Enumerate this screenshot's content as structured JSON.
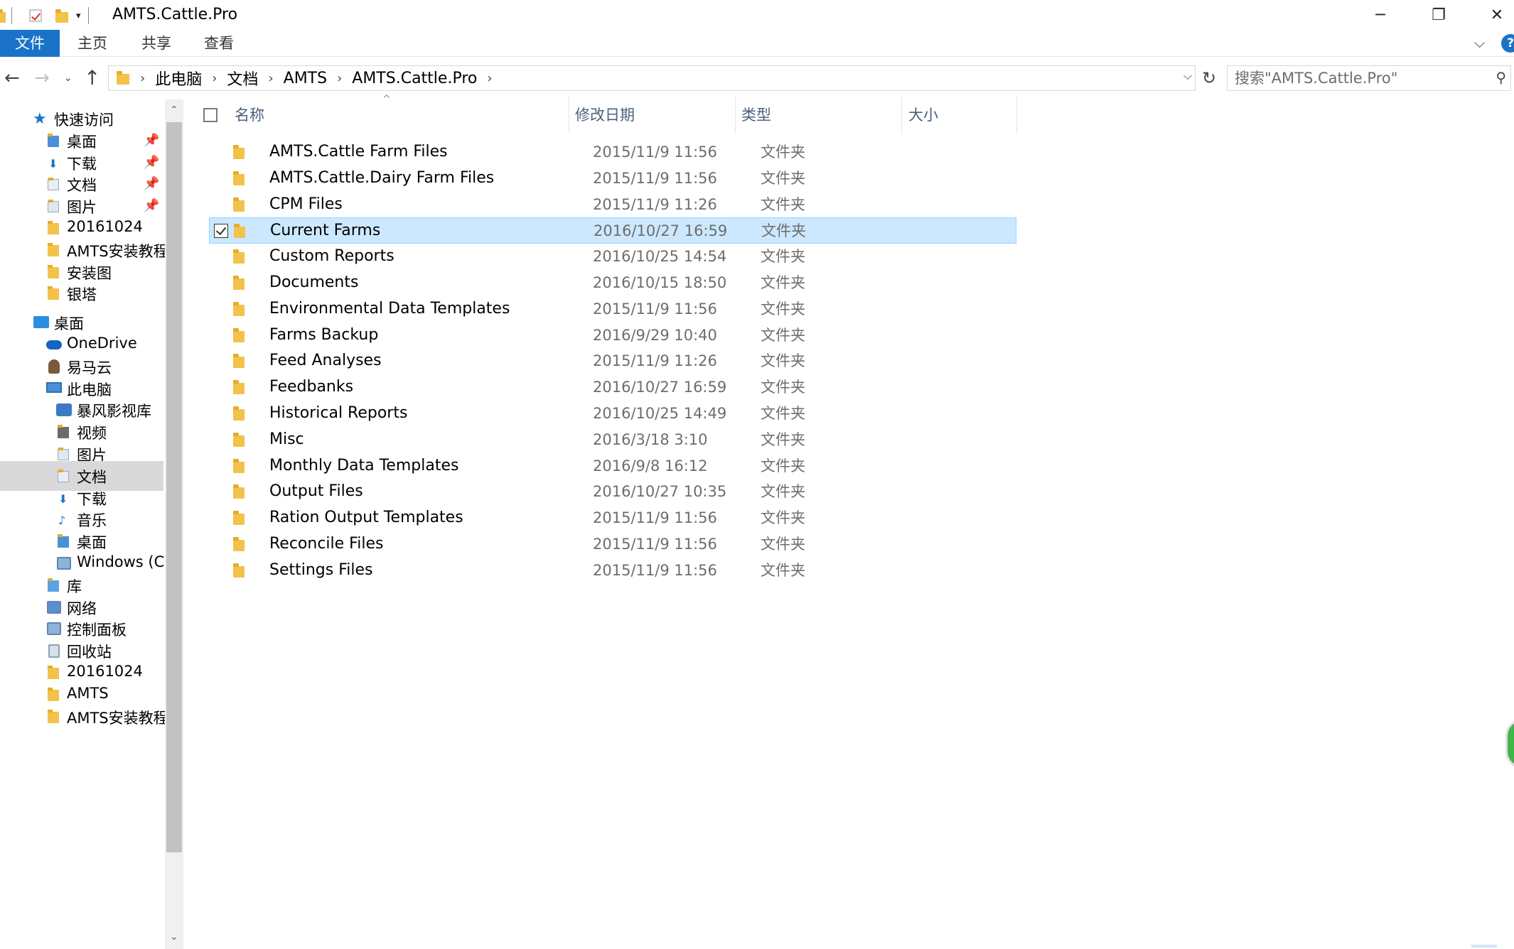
{
  "window": {
    "title": "AMTS.Cattle.Pro",
    "controls": {
      "minimize": "─",
      "maximize": "❐",
      "close": "✕"
    },
    "qat_dropdown": "▾"
  },
  "ribbon": {
    "tabs": [
      "文件",
      "主页",
      "共享",
      "查看"
    ],
    "expand_glyph": "⌵",
    "help_glyph": "?",
    "accent_color": "#1a73c9"
  },
  "navigation": {
    "back_glyph": "←",
    "forward_glyph": "→",
    "recent_glyph": "⌄",
    "up_glyph": "↑",
    "breadcrumb": [
      "此电脑",
      "文档",
      "AMTS",
      "AMTS.Cattle.Pro"
    ],
    "separator_glyph": "›",
    "dropdown_glyph": "⌵",
    "refresh_glyph": "↻",
    "search_placeholder": "搜索\"AMTS.Cattle.Pro\"",
    "search_glyph": "⚲"
  },
  "sidebar": {
    "pin_glyph": "📌",
    "items": [
      {
        "label": "快速访问",
        "icon": "star-icon",
        "indent": 0
      },
      {
        "label": "桌面",
        "icon": "desktop-folder-icon",
        "indent": 1,
        "pinned": true
      },
      {
        "label": "下载",
        "icon": "downloads-folder-icon",
        "indent": 1,
        "pinned": true
      },
      {
        "label": "文档",
        "icon": "documents-folder-icon",
        "indent": 1,
        "pinned": true
      },
      {
        "label": "图片",
        "icon": "pictures-folder-icon",
        "indent": 1,
        "pinned": true
      },
      {
        "label": "20161024",
        "icon": "folder-icon",
        "indent": 1
      },
      {
        "label": "AMTS安装教程",
        "icon": "folder-icon",
        "indent": 1
      },
      {
        "label": "安装图",
        "icon": "folder-icon",
        "indent": 1
      },
      {
        "label": "银塔",
        "icon": "folder-icon",
        "indent": 1
      },
      {
        "label": "桌面",
        "icon": "desktop-icon",
        "indent": 0
      },
      {
        "label": "OneDrive",
        "icon": "onedrive-icon",
        "indent": 1
      },
      {
        "label": "易马云",
        "icon": "user-folder-icon",
        "indent": 1
      },
      {
        "label": "此电脑",
        "icon": "computer-icon",
        "indent": 1
      },
      {
        "label": "暴风影视库",
        "icon": "media-library-icon",
        "indent": 2
      },
      {
        "label": "视频",
        "icon": "videos-folder-icon",
        "indent": 2
      },
      {
        "label": "图片",
        "icon": "pictures-folder-icon",
        "indent": 2
      },
      {
        "label": "文档",
        "icon": "documents-folder-icon",
        "indent": 2,
        "selected": true
      },
      {
        "label": "下载",
        "icon": "downloads-folder-icon",
        "indent": 2
      },
      {
        "label": "音乐",
        "icon": "music-folder-icon",
        "indent": 2
      },
      {
        "label": "桌面",
        "icon": "desktop-folder-icon",
        "indent": 2
      },
      {
        "label": "Windows (C:)",
        "icon": "drive-icon",
        "indent": 2
      },
      {
        "label": "库",
        "icon": "libraries-icon",
        "indent": 1
      },
      {
        "label": "网络",
        "icon": "network-icon",
        "indent": 1
      },
      {
        "label": "控制面板",
        "icon": "control-panel-icon",
        "indent": 1
      },
      {
        "label": "回收站",
        "icon": "recycle-bin-icon",
        "indent": 1
      },
      {
        "label": "20161024",
        "icon": "folder-icon",
        "indent": 1
      },
      {
        "label": "AMTS",
        "icon": "folder-icon",
        "indent": 1
      },
      {
        "label": "AMTS安装教程",
        "icon": "folder-icon",
        "indent": 1
      }
    ],
    "scroll_up_glyph": "⌃",
    "scroll_down_glyph": "⌄"
  },
  "file_list": {
    "columns": {
      "name": "名称",
      "modified": "修改日期",
      "type": "类型",
      "size": "大小"
    },
    "sort_glyph": "^",
    "rows": [
      {
        "name": "AMTS.Cattle Farm Files",
        "modified": "2015/11/9 11:56",
        "type": "文件夹"
      },
      {
        "name": "AMTS.Cattle.Dairy Farm Files",
        "modified": "2015/11/9 11:56",
        "type": "文件夹"
      },
      {
        "name": "CPM Files",
        "modified": "2015/11/9 11:26",
        "type": "文件夹"
      },
      {
        "name": "Current Farms",
        "modified": "2016/10/27 16:59",
        "type": "文件夹",
        "selected": true
      },
      {
        "name": "Custom Reports",
        "modified": "2016/10/25 14:54",
        "type": "文件夹"
      },
      {
        "name": "Documents",
        "modified": "2016/10/15 18:50",
        "type": "文件夹"
      },
      {
        "name": "Environmental Data Templates",
        "modified": "2015/11/9 11:56",
        "type": "文件夹"
      },
      {
        "name": "Farms Backup",
        "modified": "2016/9/29 10:40",
        "type": "文件夹"
      },
      {
        "name": "Feed Analyses",
        "modified": "2015/11/9 11:26",
        "type": "文件夹"
      },
      {
        "name": "Feedbanks",
        "modified": "2016/10/27 16:59",
        "type": "文件夹"
      },
      {
        "name": "Historical Reports",
        "modified": "2016/10/25 14:49",
        "type": "文件夹"
      },
      {
        "name": "Misc",
        "modified": "2016/3/18 3:10",
        "type": "文件夹"
      },
      {
        "name": "Monthly Data Templates",
        "modified": "2016/9/8 16:12",
        "type": "文件夹"
      },
      {
        "name": "Output Files",
        "modified": "2016/10/27 10:35",
        "type": "文件夹"
      },
      {
        "name": "Ration Output Templates",
        "modified": "2015/11/9 11:56",
        "type": "文件夹"
      },
      {
        "name": "Reconcile Files",
        "modified": "2015/11/9 11:56",
        "type": "文件夹"
      },
      {
        "name": "Settings Files",
        "modified": "2015/11/9 11:56",
        "type": "文件夹"
      }
    ],
    "selected_color": "#cce8ff",
    "header_text_color": "#4c607a"
  }
}
